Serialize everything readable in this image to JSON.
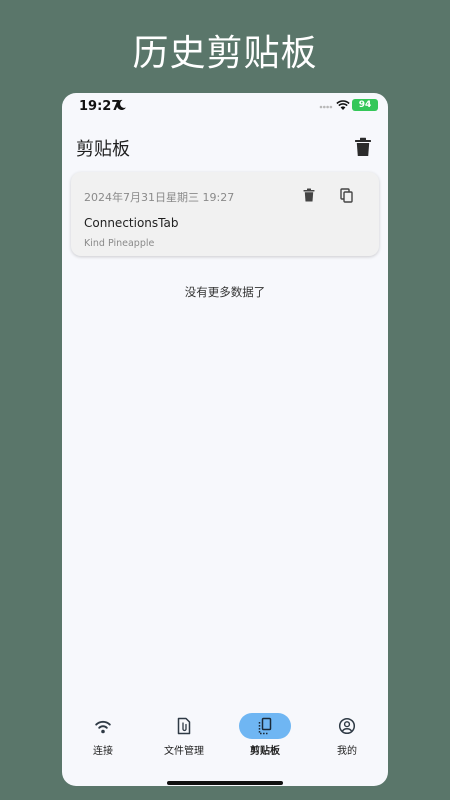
{
  "banner": {
    "title": "历史剪贴板"
  },
  "status_bar": {
    "time": "19:27",
    "battery": "94"
  },
  "app_bar": {
    "title": "剪贴板"
  },
  "clipboard_items": [
    {
      "timestamp": "2024年7月31日星期三 19:27",
      "content": "ConnectionsTab",
      "source_device": "Kind Pineapple"
    }
  ],
  "list_footer": "没有更多数据了",
  "bottom_nav": {
    "items": [
      {
        "label": "连接",
        "icon": "wifi-icon"
      },
      {
        "label": "文件管理",
        "icon": "file-attachment-icon"
      },
      {
        "label": "剪贴板",
        "icon": "clipboard-icon",
        "active": true
      },
      {
        "label": "我的",
        "icon": "account-circle-icon"
      }
    ]
  },
  "colors": {
    "background": "#5a766a",
    "screen": "#f7f8fc",
    "card": "#f1f1f1",
    "active_pill": "#6fb6f3",
    "battery": "#34c759"
  }
}
